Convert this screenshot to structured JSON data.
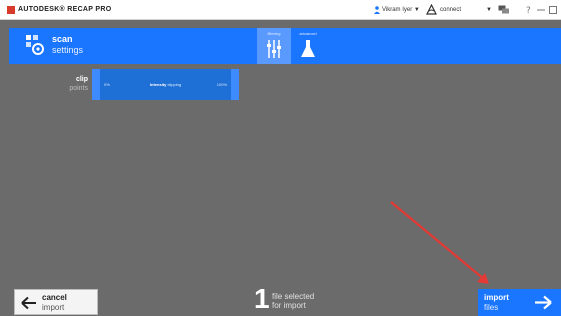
{
  "titlebar": {
    "app_name": "AUTODESK® RECAP PRO",
    "user_label": "Vikram Iyer",
    "connect_label": "connect",
    "caret": "▼"
  },
  "header": {
    "title": "scan",
    "subtitle": "settings",
    "tabs": [
      {
        "label": "filtering",
        "active": true,
        "icon": "filter-sliders-icon"
      },
      {
        "label": "advanced",
        "active": false,
        "icon": "flask-icon"
      }
    ],
    "accent_color": "#1a75ff"
  },
  "clip": {
    "label": "clip",
    "sublabel": "points",
    "slider": {
      "min_label": "0%",
      "max_label": "100%",
      "title_bold": "Intensity",
      "title_rest": "clipping"
    }
  },
  "footer": {
    "cancel": {
      "line1": "cancel",
      "line2": "import",
      "icon": "arrow-left-icon"
    },
    "count": "1",
    "status_line1": "file selected",
    "status_line2": "for import",
    "import": {
      "line1": "import",
      "line2": "files",
      "icon": "arrow-right-icon"
    }
  },
  "annotation": {
    "color": "#e53935"
  }
}
